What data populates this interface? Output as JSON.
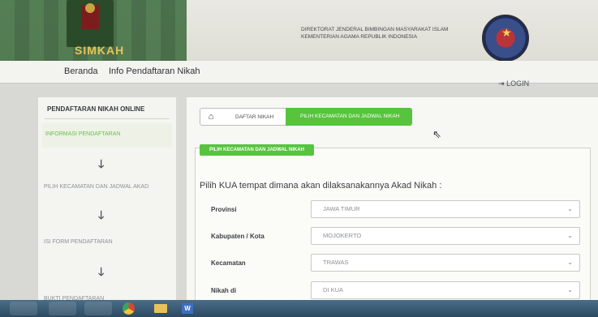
{
  "header": {
    "app_name": "SIMKAH",
    "org_line1": "DIREKTORAT JENDERAL BIMBINGAN MASYARAKAT ISLAM",
    "org_line2": "KEMENTERIAN AGAMA REPUBLIK INDONESIA"
  },
  "nav": {
    "items": [
      "Beranda",
      "Info Pendaftaran Nikah"
    ],
    "login": "LOGIN"
  },
  "sidebar": {
    "title": "PENDAFTARAN NIKAH ONLINE",
    "steps": [
      "INFORMASI PENDAFTARAN",
      "PILIH KECAMATAN DAN JADWAL AKAD",
      "ISI FORM PENDAFTARAN",
      "BUKTI PENDAFTARAN"
    ],
    "active_step": 0
  },
  "breadcrumb": {
    "items": [
      "DAFTAR NIKAH",
      "PILIH KECAMATAN DAN JADWAL NIKAH"
    ]
  },
  "section": {
    "title": "PILIH KECAMATAN DAN JADWAL NIKAH",
    "intro": "Pilih KUA tempat dimana akan dilaksanakannya Akad Nikah :"
  },
  "form": {
    "fields": [
      {
        "label": "Provinsi",
        "value": "JAWA TIMUR"
      },
      {
        "label": "Kabupaten / Kota",
        "value": "MOJOKERTO"
      },
      {
        "label": "Kecamatan",
        "value": "TRAWAS"
      },
      {
        "label": "Nikah di",
        "value": "DI KUA"
      }
    ]
  },
  "colors": {
    "accent_green": "#56c43d",
    "app_name_gold": "#e6c356"
  },
  "icons": {
    "home": "home-icon",
    "login": "login-icon",
    "chevron": "chevron-down-icon",
    "arrow": "arrow-down-icon",
    "cursor": "mouse-cursor-icon"
  }
}
